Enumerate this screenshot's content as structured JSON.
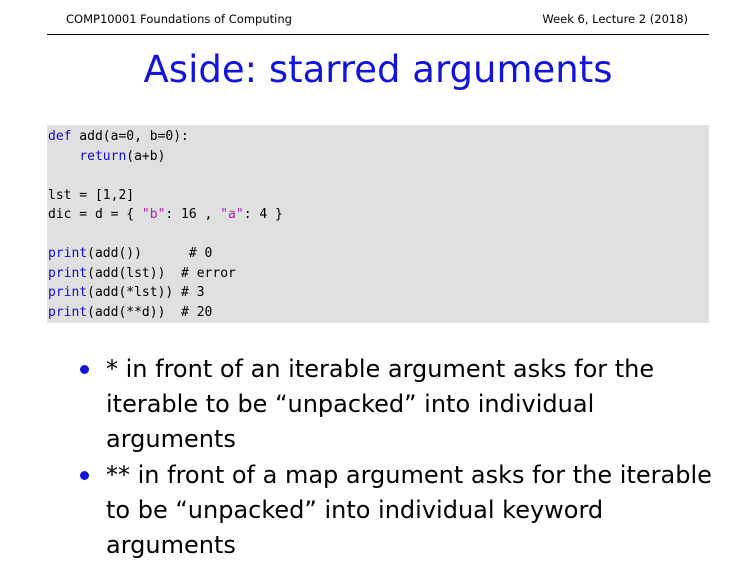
{
  "header": {
    "course": "COMP10001 Foundations of Computing",
    "lecture": "Week 6, Lecture 2 (2018)"
  },
  "title": "Aside: starred arguments",
  "code": {
    "line1": {
      "kw": "def",
      "rest": " add(a=0, b=0):"
    },
    "line2": {
      "indent": "    ",
      "kw": "return",
      "rest": "(a+b)"
    },
    "line3": "",
    "line4": "lst = [1,2]",
    "line5": {
      "pre": "dic = d = { ",
      "s1": "\"b\"",
      "mid": ": 16 , ",
      "s2": "\"a\"",
      "post": ": 4 }"
    },
    "line6": "",
    "line7": {
      "kw": "print",
      "rest": "(add())      # 0"
    },
    "line8": {
      "kw": "print",
      "rest": "(add(lst))  # error"
    },
    "line9": {
      "kw": "print",
      "rest": "(add(*lst)) # 3"
    },
    "line10": {
      "kw": "print",
      "rest": "(add(**d))  # 20"
    }
  },
  "bullets": [
    "* in front of an iterable argument asks for the iterable to be “unpacked” into individual arguments",
    "** in front of a map argument asks for the iterable to be “unpacked” into individual keyword arguments"
  ],
  "colors": {
    "accent": "#1414d9",
    "keyword": "#1010c8",
    "string": "#b020b0",
    "code_bg": "#e0e0e0"
  }
}
